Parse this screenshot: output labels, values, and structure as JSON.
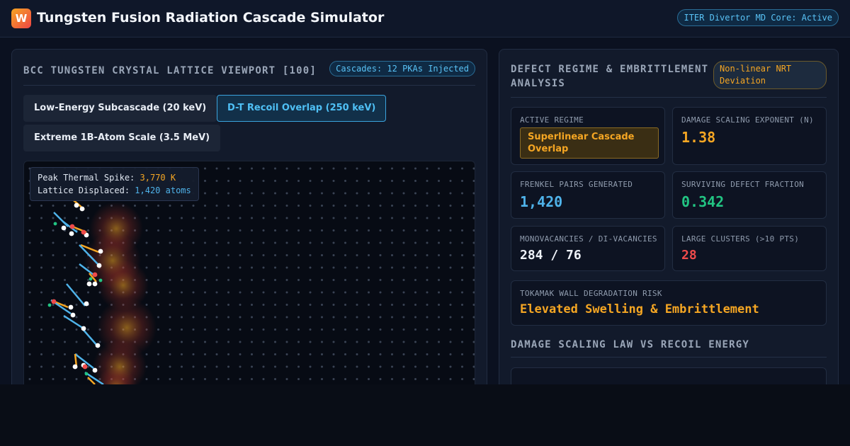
{
  "app": {
    "logo_letter": "W",
    "title": "Tungsten Fusion Radiation Cascade Simulator",
    "status": "ITER Divertor MD Core: Active"
  },
  "viewport_panel": {
    "title": "BCC TUNGSTEN CRYSTAL LATTICE VIEWPORT [100]",
    "badge": "Cascades: 12 PKAs Injected",
    "tabs": [
      {
        "label": "Low-Energy Subcascade (20 keV)",
        "active": false
      },
      {
        "label": "D-T Recoil Overlap (250 keV)",
        "active": true
      },
      {
        "label": "Extreme 1B-Atom Scale (3.5 MeV)",
        "active": false
      }
    ],
    "readout": {
      "spike_label": "Peak Thermal Spike:",
      "spike_value": "3,770 K",
      "displaced_label": "Lattice Displaced:",
      "displaced_value": "1,420 atoms"
    },
    "colors": {
      "lattice_site": "#3a4354",
      "vacancy": "#ffffff",
      "interstitial": "#ef4b4b",
      "recoil_track_blue": "#4fb3ea",
      "recoil_track_orange": "#f5a623",
      "thermal_spike": "#f5a623"
    }
  },
  "analysis_panel": {
    "title": "DEFECT REGIME & EMBRITTLEMENT ANALYSIS",
    "badge": "Non-linear NRT Deviation",
    "active_regime": {
      "label": "ACTIVE REGIME",
      "value": "Superlinear Cascade Overlap"
    },
    "scaling_exponent": {
      "label": "DAMAGE SCALING EXPONENT (N)",
      "value": "1.38"
    },
    "frenkel_pairs": {
      "label": "FRENKEL PAIRS GENERATED",
      "value": "1,420"
    },
    "surviving_fraction": {
      "label": "SURVIVING DEFECT FRACTION",
      "value": "0.342"
    },
    "vacancies": {
      "label": "MONOVACANCIES / DI-VACANCIES",
      "value": "284 / 76"
    },
    "large_clusters": {
      "label": "LARGE CLUSTERS (>10 PTS)",
      "value": "28"
    },
    "wall_risk": {
      "label": "TOKAMAK WALL DEGRADATION RISK",
      "value": "Elevated Swelling & Embrittlement"
    },
    "scaling_section_title": "DAMAGE SCALING LAW VS RECOIL ENERGY"
  }
}
